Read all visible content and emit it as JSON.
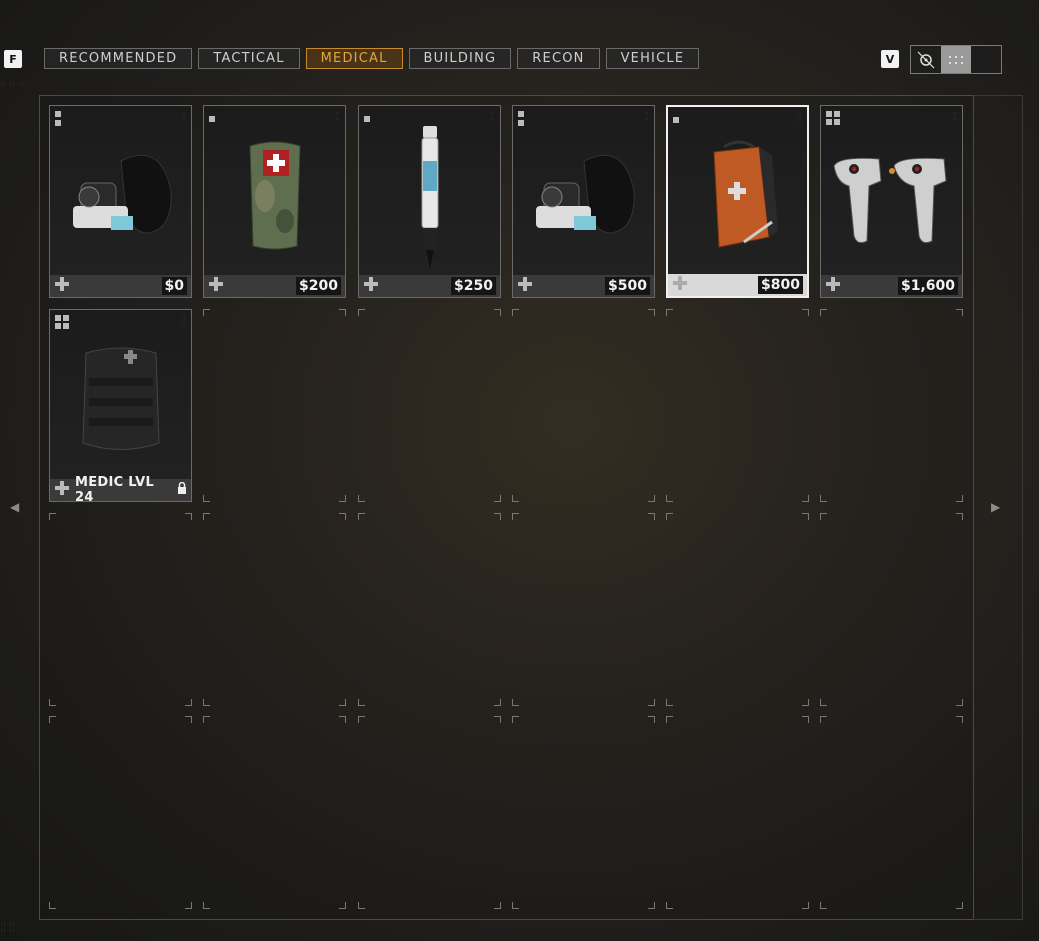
{
  "hotkeys": {
    "tabs_key": "F",
    "view_key": "V"
  },
  "tabs": [
    {
      "label": "RECOMMENDED",
      "active": false
    },
    {
      "label": "TACTICAL",
      "active": false
    },
    {
      "label": "MEDICAL",
      "active": true
    },
    {
      "label": "BUILDING",
      "active": false
    },
    {
      "label": "RECON",
      "active": false
    },
    {
      "label": "VEHICLE",
      "active": false
    }
  ],
  "items": [
    {
      "item": "oxygen-mask",
      "price": "$0"
    },
    {
      "item": "bandage",
      "price": "$200"
    },
    {
      "item": "syringe",
      "price": "$250"
    },
    {
      "item": "oxygen-mask",
      "price": "$500"
    },
    {
      "item": "medic-bag",
      "price": "$800",
      "selected": true
    },
    {
      "item": "defibrillator",
      "price": "$1,600"
    },
    {
      "item": "medic-pouch",
      "locked_label": "MEDIC LVL 24",
      "locked": true
    }
  ],
  "colors": {
    "accent": "#e7a63d",
    "selected_border": "#f0f0f0"
  }
}
